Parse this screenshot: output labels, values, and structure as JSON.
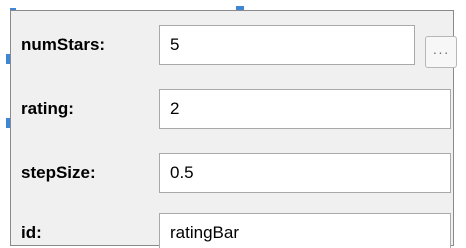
{
  "properties": [
    {
      "label": "numStars:",
      "value": "5"
    },
    {
      "label": "rating:",
      "value": "2"
    },
    {
      "label": "stepSize:",
      "value": "0.5"
    },
    {
      "label": "id:",
      "value": "ratingBar"
    }
  ],
  "ellipsis_button": {
    "label": "···",
    "icon": "ellipsis-icon"
  },
  "colors": {
    "panel_background": "#f0f0f0",
    "field_background": "#ffffff",
    "field_border": "#a9a9a9",
    "selection_marker": "#3f86d6"
  }
}
